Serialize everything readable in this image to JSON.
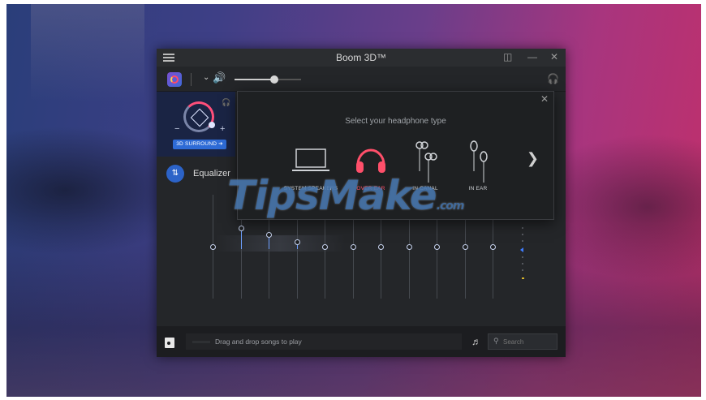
{
  "window": {
    "title": "Boom 3D™"
  },
  "toolbar": {
    "volume_level": 0.6
  },
  "surround": {
    "button_label": "3D SURROUND ➔",
    "minus": "−",
    "plus": "+"
  },
  "sidebar": {
    "equalizer_label": "Equalizer"
  },
  "headphone_popup": {
    "heading": "Select your headphone type",
    "options": [
      {
        "label": "SYSTEM SPEAKERS",
        "icon": "laptop-icon",
        "selected": false
      },
      {
        "label": "OVER EAR",
        "icon": "over-ear-headphones-icon",
        "selected": true
      },
      {
        "label": "IN CANAL",
        "icon": "in-canal-earbuds-icon",
        "selected": false
      },
      {
        "label": "IN EAR",
        "icon": "in-ear-earbuds-icon",
        "selected": false
      }
    ]
  },
  "equalizer": {
    "bands": [
      0.5,
      0.68,
      0.62,
      0.55,
      0.5,
      0.5,
      0.5,
      0.5,
      0.5,
      0.5,
      0.5
    ]
  },
  "player": {
    "drop_text": "Drag and drop songs to play",
    "search_placeholder": "Search"
  },
  "watermark": {
    "text": "TipsMake",
    "domain": ".com"
  },
  "colors": {
    "accent": "#2e6bd6",
    "selected": "#ff4f6a"
  }
}
